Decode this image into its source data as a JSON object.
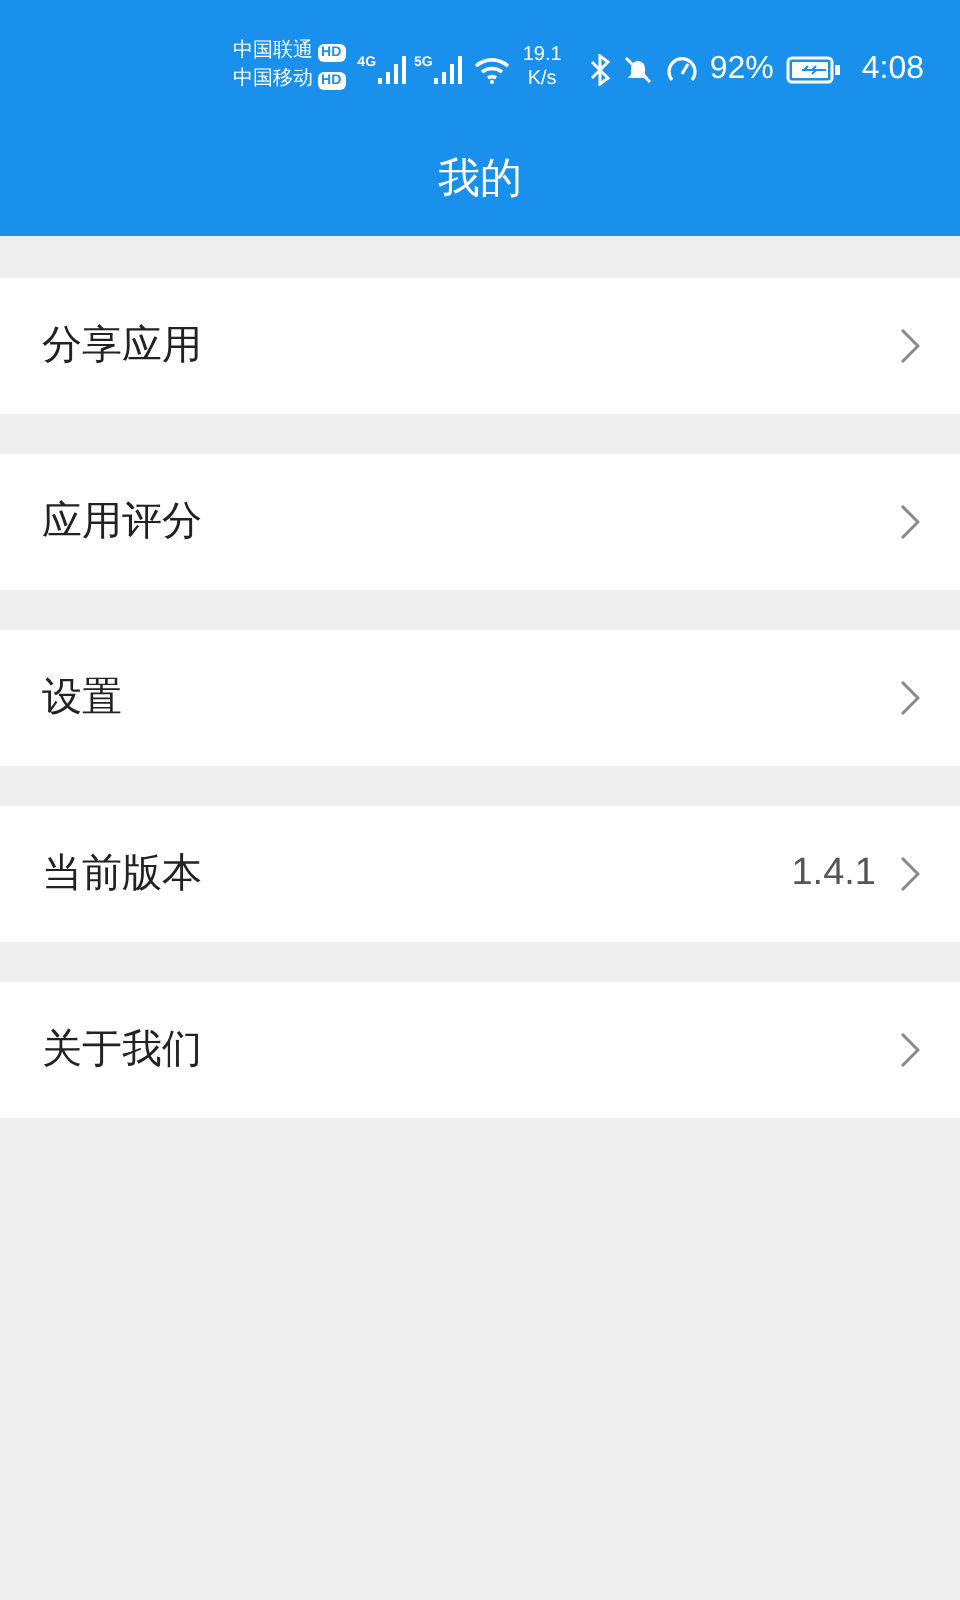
{
  "status_bar": {
    "carriers": [
      {
        "name": "中国联通",
        "badge": "HD",
        "network": "4G"
      },
      {
        "name": "中国移动",
        "badge": "HD",
        "network": "5G"
      }
    ],
    "speed_value": "19.1",
    "speed_unit": "K/s",
    "battery": "92%",
    "time": "4:08"
  },
  "header": {
    "title": "我的"
  },
  "menu": [
    {
      "label": "分享应用"
    },
    {
      "label": "应用评分"
    },
    {
      "label": "设置"
    },
    {
      "label": "当前版本",
      "value": "1.4.1"
    },
    {
      "label": "关于我们"
    }
  ]
}
